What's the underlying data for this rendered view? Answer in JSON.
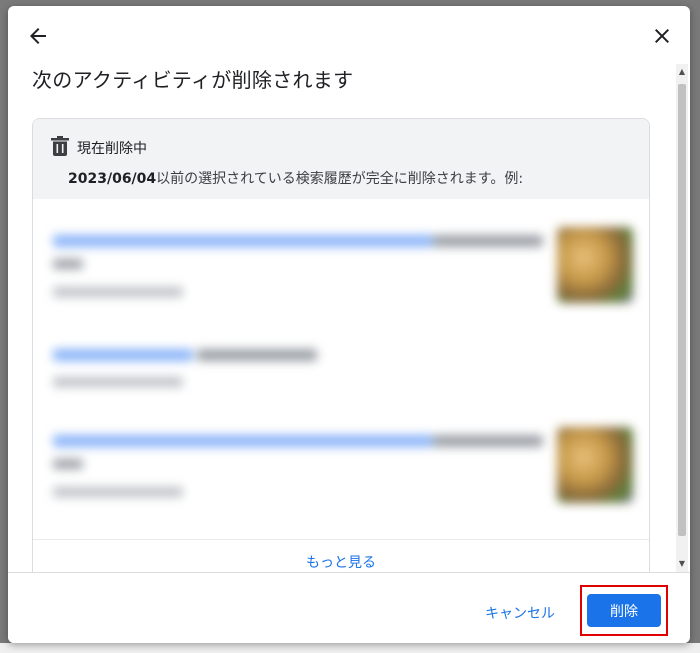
{
  "dialog": {
    "title": "次のアクティビティが削除されます",
    "status_label": "現在削除中",
    "description_date": "2023/06/04",
    "description_rest": "以前の選択されている検索履歴が完全に削除されます。例:",
    "more_link": "もっと見る",
    "cancel_label": "キャンセル",
    "delete_label": "削除"
  },
  "colors": {
    "accent": "#1a73e8",
    "highlight_border": "#e00000",
    "card_header_bg": "#f1f3f4"
  },
  "icons": [
    "back-arrow-icon",
    "close-icon",
    "trash-icon"
  ]
}
